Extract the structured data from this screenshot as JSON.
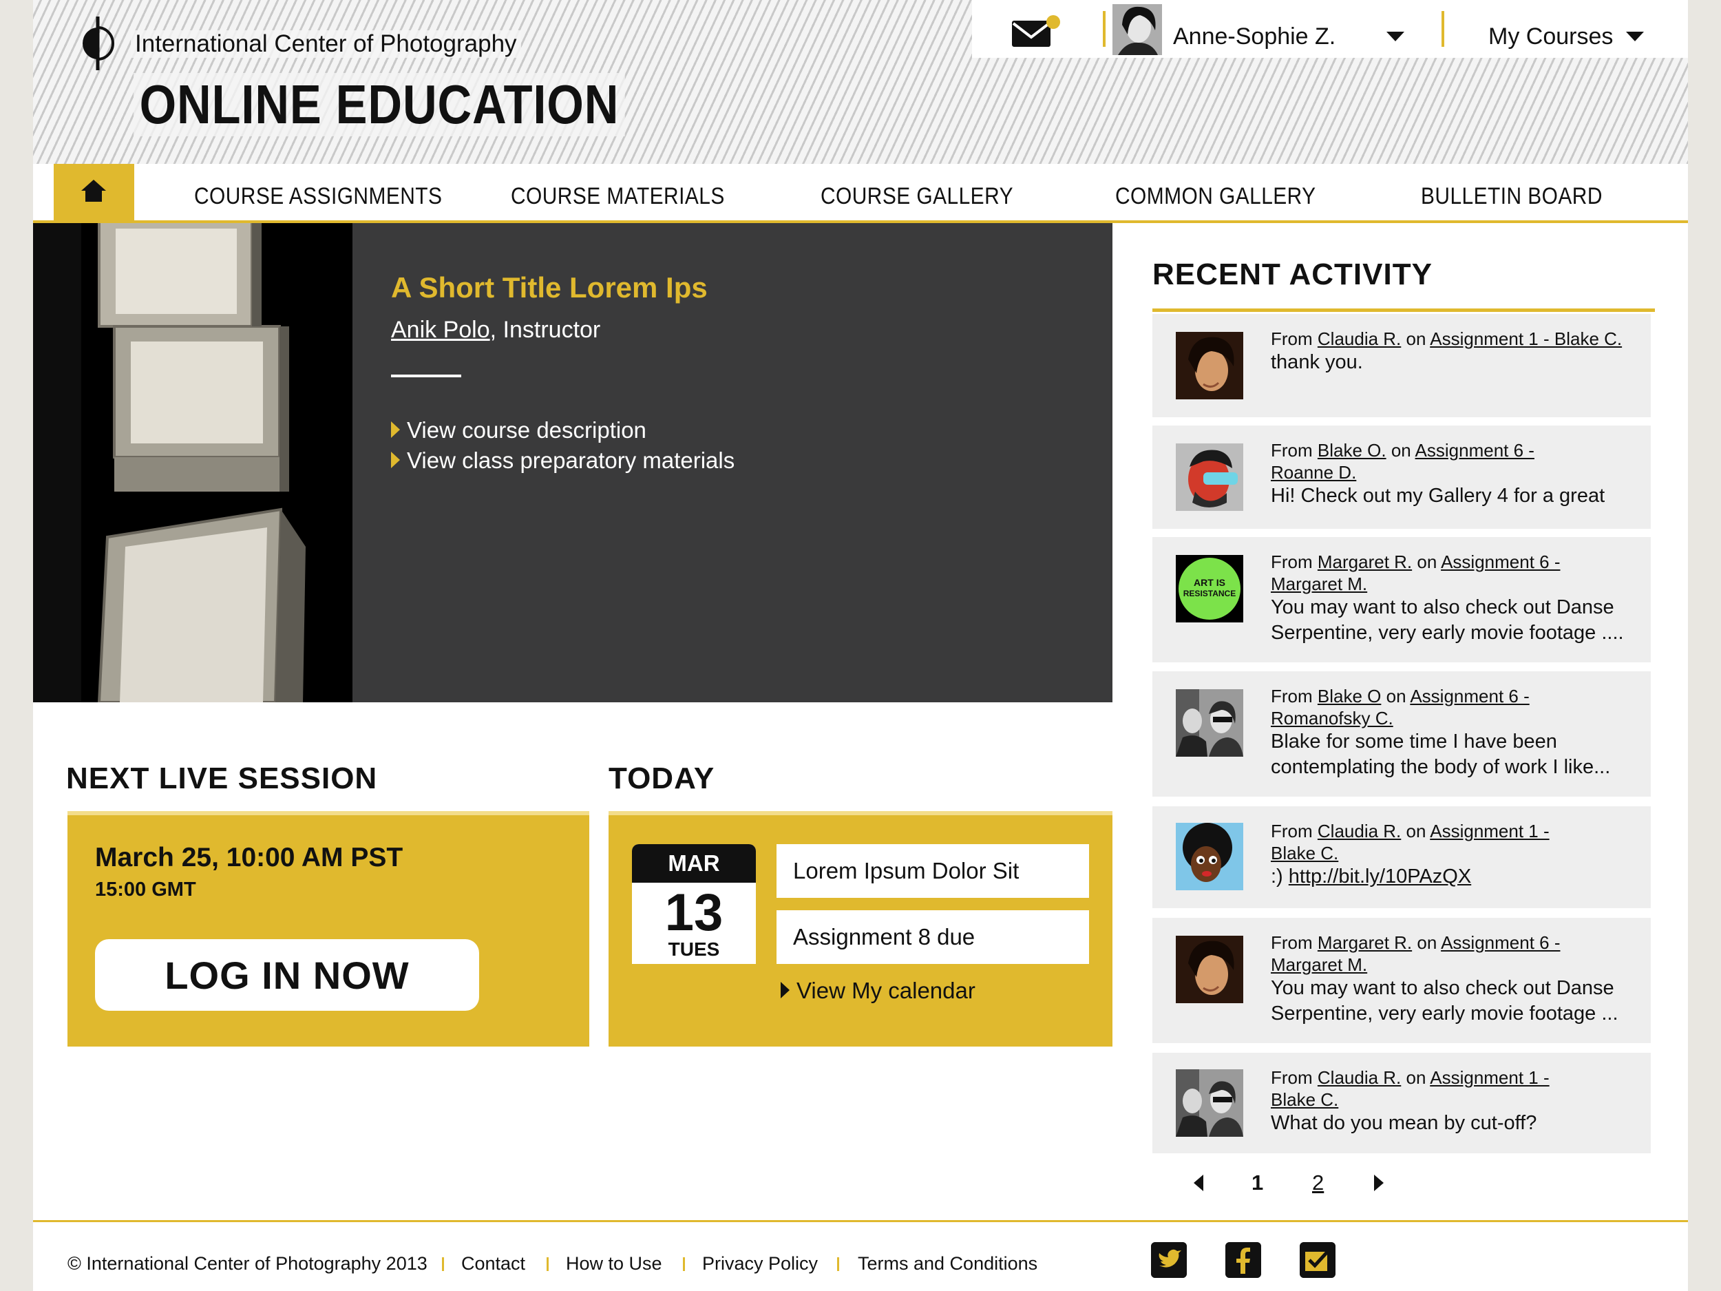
{
  "brand": {
    "org_name": "International Center of Photography",
    "title": "ONLINE EDUCATION"
  },
  "userbar": {
    "user_name": "Anne-Sophie Z.",
    "courses_label": "My Courses"
  },
  "nav": {
    "items": [
      "COURSE ASSIGNMENTS",
      "COURSE MATERIALS",
      "COURSE GALLERY",
      "COMMON GALLERY",
      "BULLETIN BOARD"
    ]
  },
  "hero": {
    "title": "A Short Title Lorem Ips",
    "instructor_name": "Anik Polo",
    "instructor_role": ", Instructor",
    "links": [
      "View course description",
      "View class preparatory materials"
    ]
  },
  "live_session": {
    "heading": "NEXT LIVE SESSION",
    "date": "March 25, 10:00 AM PST",
    "gmt": "15:00 GMT",
    "login_label": "LOG IN NOW"
  },
  "today": {
    "heading": "TODAY",
    "month": "MAR",
    "day": "13",
    "weekday": "TUES",
    "items": [
      "Lorem Ipsum Dolor Sit",
      "Assignment 8 due"
    ],
    "calendar_link": "View My calendar"
  },
  "activity": {
    "heading": "RECENT ACTIVITY",
    "items": [
      {
        "from": "Claudia R.",
        "on_1": "Assignment 1 - Blake C.",
        "on_2": "",
        "message": "thank you."
      },
      {
        "from": "Blake O.",
        "on_1": "Assignment 6 -",
        "on_2": "Roanne D.",
        "message": "Hi! Check out my Gallery 4 for a great"
      },
      {
        "from": "Margaret R.",
        "on_1": "Assignment 6 -",
        "on_2": "Margaret M.",
        "message": "You may want to also check out Danse Serpentine, very early movie footage ...."
      },
      {
        "from": "Blake O",
        "on_1": "Assignment 6 -",
        "on_2": "Romanofsky C.",
        "message": "Blake for some time I have been contemplating the body of work I like..."
      },
      {
        "from": "Claudia R.",
        "on_1": "Assignment 1 -",
        "on_2": "Blake C.",
        "message_prefix": ":) ",
        "message_link": "http://bit.ly/10PAzQX"
      },
      {
        "from": "Margaret R.",
        "on_1": "Assignment 6 -",
        "on_2": "Margaret M.",
        "message": "You may want to also check out Danse Serpentine, very early movie footage ..."
      },
      {
        "from": "Claudia R.",
        "on_1": "Assignment 1 -",
        "on_2": "Blake C.",
        "message": "What do you mean by cut-off?"
      }
    ],
    "labels": {
      "from": "From ",
      "on": " on "
    },
    "badge_text": [
      "ART IS",
      "RESISTANCE"
    ],
    "pages": [
      "1",
      "2"
    ]
  },
  "footer": {
    "copyright": "© International Center of Photography 2013",
    "links": [
      "Contact",
      "How to Use",
      "Privacy Policy",
      "Terms and Conditions"
    ]
  },
  "colors": {
    "accent": "#e0b92e",
    "hero_bg": "#3a3a3b",
    "card_bg": "#eeeeee"
  },
  "icons": [
    "mail-icon",
    "home-icon",
    "twitter-icon",
    "facebook-icon",
    "checkin-icon"
  ]
}
